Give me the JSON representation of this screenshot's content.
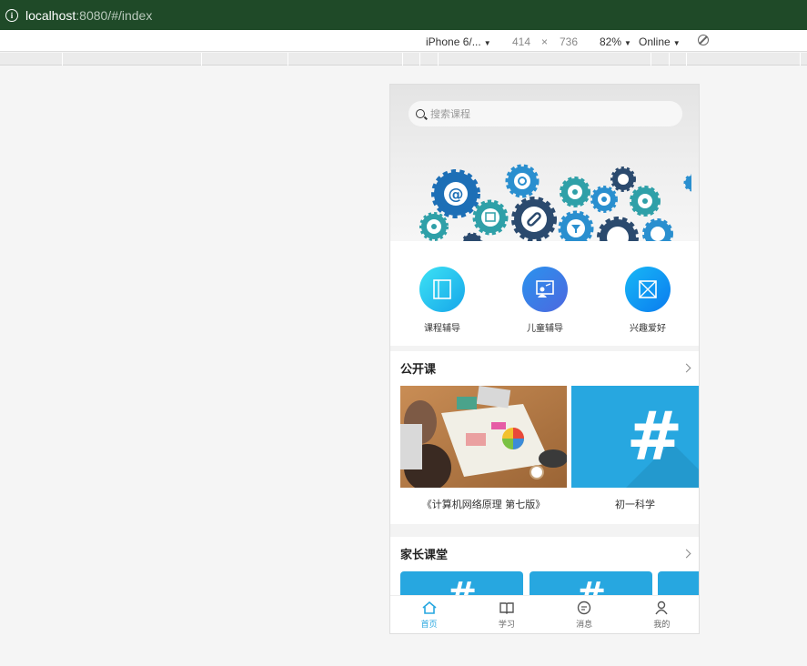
{
  "browser": {
    "url_host": "localhost",
    "url_rest": ":8080/#/index"
  },
  "device_toolbar": {
    "device": "iPhone 6/...",
    "width": "414",
    "times": "×",
    "height": "736",
    "zoom": "82%",
    "network": "Online"
  },
  "search": {
    "placeholder": "搜索课程"
  },
  "categories": [
    {
      "label": "课程辅导",
      "color_from": "#35d6f2",
      "color_to": "#1aa8ea"
    },
    {
      "label": "儿童辅导",
      "color_from": "#2d8cf0",
      "color_to": "#4a6fe0"
    },
    {
      "label": "兴趣爱好",
      "color_from": "#16b2f5",
      "color_to": "#0a7ff0"
    }
  ],
  "open_course": {
    "title": "公开课",
    "items": [
      {
        "title": "《计算机网络原理 第七版》"
      },
      {
        "title": "初一科学",
        "glyph": "#"
      }
    ]
  },
  "parent_class": {
    "title": "家长课堂",
    "glyph": "#"
  },
  "tabs": [
    {
      "label": "首页",
      "icon": "home-icon",
      "active": true
    },
    {
      "label": "学习",
      "icon": "book-icon",
      "active": false
    },
    {
      "label": "消息",
      "icon": "message-icon",
      "active": false
    },
    {
      "label": "我的",
      "icon": "user-icon",
      "active": false
    }
  ],
  "colors": {
    "accent": "#27a7e0",
    "address_bar": "#1f4a28"
  }
}
